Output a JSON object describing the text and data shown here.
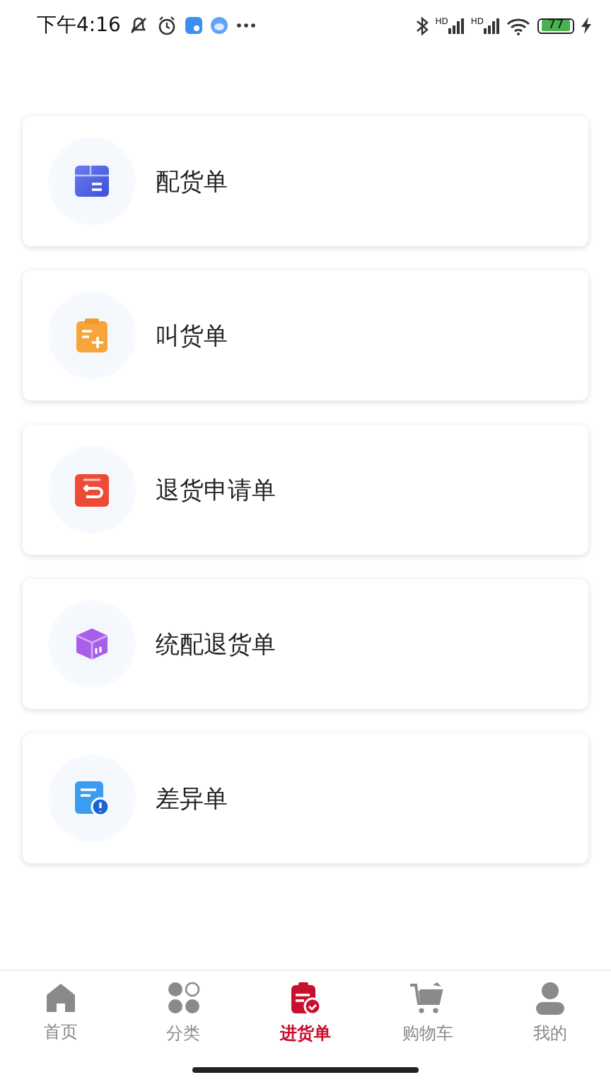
{
  "status_bar": {
    "time": "下午4:16",
    "signal_labels": [
      "HD",
      "HD"
    ],
    "battery": "77"
  },
  "menu": [
    {
      "label": "配货单",
      "kind": "box"
    },
    {
      "label": "叫货单",
      "kind": "clipboard"
    },
    {
      "label": "退货申请单",
      "kind": "return"
    },
    {
      "label": "统配退货单",
      "kind": "package"
    },
    {
      "label": "差异单",
      "kind": "alert"
    }
  ],
  "tab_bar": [
    {
      "label": "首页",
      "kind": "home",
      "selected": false
    },
    {
      "label": "分类",
      "kind": "category",
      "selected": false
    },
    {
      "label": "进货单",
      "kind": "order",
      "selected": true
    },
    {
      "label": "购物车",
      "kind": "cart",
      "selected": false
    },
    {
      "label": "我的",
      "kind": "user",
      "selected": false
    }
  ]
}
